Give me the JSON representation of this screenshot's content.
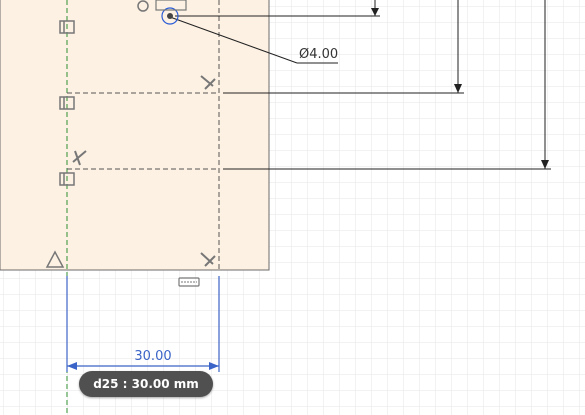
{
  "sketch": {
    "profile_fill": "#fdf1e3",
    "hole_diameter_label": "Ø4.00",
    "width_dimension_label": "30.00",
    "dimension_color": "#3b64c8"
  },
  "tooltip": {
    "label": "d25 : 30.00 mm"
  },
  "constraint_icons": [
    "coincident-icon",
    "coincident-icon",
    "coincident-icon",
    "fix-triangle-icon",
    "perpendicular-icon",
    "perpendicular-icon",
    "perpendicular-icon",
    "horizontal-bar-icon",
    "hole-center-icon"
  ]
}
